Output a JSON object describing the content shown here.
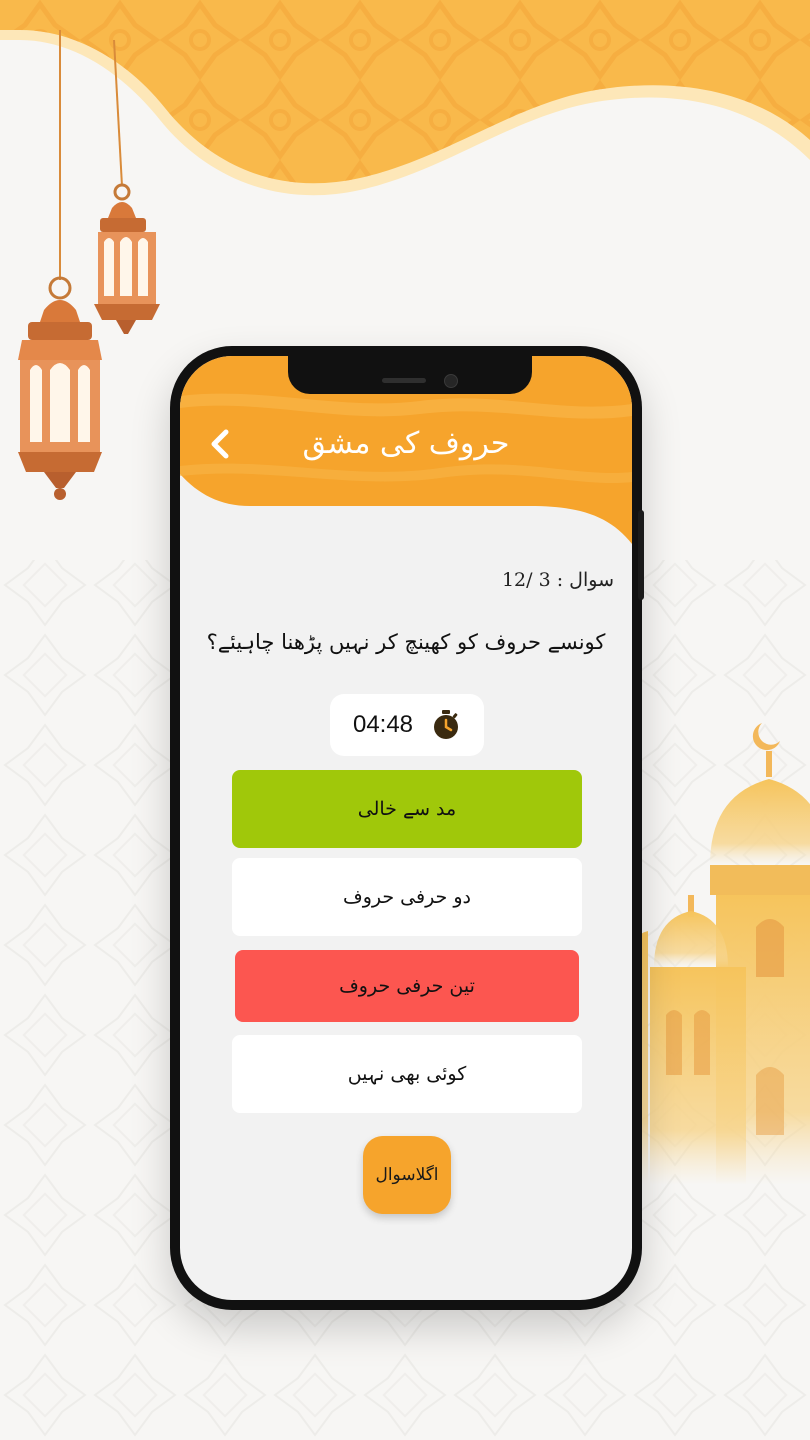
{
  "colors": {
    "primary": "#f6a42c",
    "correct": "#a0c80a",
    "wrong": "#fc5650",
    "option_default": "#ffffff",
    "screen_bg": "#f2f2f2"
  },
  "header": {
    "title": "حروف کی مشق",
    "back_icon": "chevron-left-icon"
  },
  "quiz": {
    "counter": "سوال : 3 /12",
    "question": "کونسے حروف کو کھینچ کر نہیں پڑھنا چاہیئے؟",
    "timer": {
      "value": "04:48",
      "icon": "stopwatch-icon"
    },
    "options": [
      {
        "label": "مد سے خالی",
        "state": "correct"
      },
      {
        "label": "دو حرفی حروف",
        "state": "default"
      },
      {
        "label": "تین حرفی حروف",
        "state": "wrong"
      },
      {
        "label": "کوئی بھی نہیں",
        "state": "default"
      }
    ],
    "next_label": "اگلاسوال"
  }
}
